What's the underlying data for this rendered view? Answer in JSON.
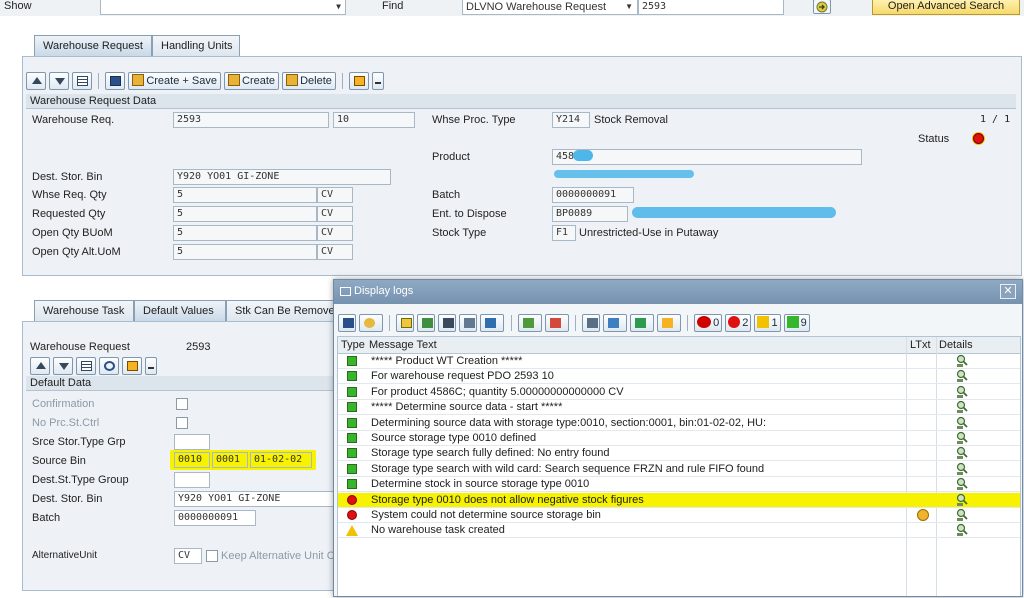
{
  "top": {
    "show_label": "Show",
    "find_label": "Find",
    "find_select": "DLVNO Warehouse Request",
    "find_value": "2593",
    "advanced_button": "Open Advanced Search"
  },
  "upper_tabs": [
    "Warehouse Request",
    "Handling Units"
  ],
  "toolbar": {
    "create_save": "Create + Save",
    "create": "Create",
    "delete": "Delete"
  },
  "wr_section": {
    "header": "Warehouse Request Data",
    "whse_req_label": "Warehouse Req.",
    "whse_req_value": "2593",
    "whse_req_item": "10",
    "proc_type_label": "Whse Proc. Type",
    "proc_type_code": "Y214",
    "proc_type_text": "Stock Removal",
    "counter": "1 / 1",
    "status_label": "Status",
    "product_label": "Product",
    "product_value": "458",
    "dest_bin_label": "Dest. Stor. Bin",
    "dest_bin_value": "Y920 YO01 GI-ZONE",
    "whse_qty_label": "Whse Req. Qty",
    "whse_qty_value": "5",
    "whse_qty_uom": "CV",
    "batch_label": "Batch",
    "batch_value": "0000000091",
    "req_qty_label": "Requested Qty",
    "req_qty_value": "5",
    "req_qty_uom": "CV",
    "ent_label": "Ent. to Dispose",
    "ent_value": "BP0089",
    "open_qty_label": "Open Qty BUoM",
    "open_qty_value": "5",
    "open_qty_uom": "CV",
    "stock_type_label": "Stock Type",
    "stock_type_code": "F1",
    "stock_type_text": "Unrestricted-Use in Putaway",
    "open_alt_label": "Open Qty Alt.UoM",
    "open_alt_value": "5",
    "open_alt_uom": "CV"
  },
  "lower_tabs": [
    "Warehouse Task",
    "Default Values",
    "Stk Can Be Remove"
  ],
  "defaults": {
    "wr_label": "Warehouse Request",
    "wr_value": "2593",
    "header": "Default Data",
    "confirmation": "Confirmation",
    "no_prc": "No Prc.St.Ctrl",
    "srce_grp": "Srce Stor.Type Grp",
    "source_bin_label": "Source Bin",
    "source_bin_type": "0010",
    "source_bin_section": "0001",
    "source_bin_bin": "01-02-02",
    "dest_grp": "Dest.St.Type Group",
    "dest_bin_label": "Dest. Stor. Bin",
    "dest_bin_value": "Y920 YO01 GI-ZONE",
    "batch_label": "Batch",
    "batch_value": "0000000091",
    "alt_unit_label": "AlternativeUnit",
    "alt_unit_value": "CV",
    "keep_alt": "Keep Alternative Unit C"
  },
  "dialog": {
    "title": "Display logs",
    "counts": {
      "stop": "0",
      "error": "2",
      "warning": "1",
      "success": "9"
    },
    "col_type": "Type",
    "col_msg": "Message Text",
    "col_ltxt": "LTxt",
    "col_details": "Details",
    "rows": [
      {
        "type": "success",
        "text": "*****  Product WT Creation  *****"
      },
      {
        "type": "success",
        "text": "For warehouse request PDO 2593 10"
      },
      {
        "type": "success",
        "text": "For product 4586C; quantity 5.00000000000000 CV"
      },
      {
        "type": "success",
        "text": "*****  Determine source data - start  *****"
      },
      {
        "type": "success",
        "text": "Determining source data with storage type:0010, section:0001, bin:01-02-02, HU:"
      },
      {
        "type": "success",
        "text": "Source storage type 0010 defined"
      },
      {
        "type": "success",
        "text": "Storage type search fully defined: No entry found"
      },
      {
        "type": "success",
        "text": "Storage type search with wild card: Search sequence FRZN and rule FIFO found"
      },
      {
        "type": "success",
        "text": "Determine stock in source storage type 0010"
      },
      {
        "type": "error",
        "text": "Storage type 0010 does not allow negative stock figures"
      },
      {
        "type": "error",
        "text": "System could not determine source storage bin"
      },
      {
        "type": "warning",
        "text": "No warehouse task created"
      }
    ]
  },
  "colors": {
    "highlight": "#f7f200",
    "success": "#36b62a",
    "error": "#e01010",
    "warning": "#f2c200",
    "dialog_title": "#7c9ab8",
    "redact": "#4fb6ea"
  }
}
